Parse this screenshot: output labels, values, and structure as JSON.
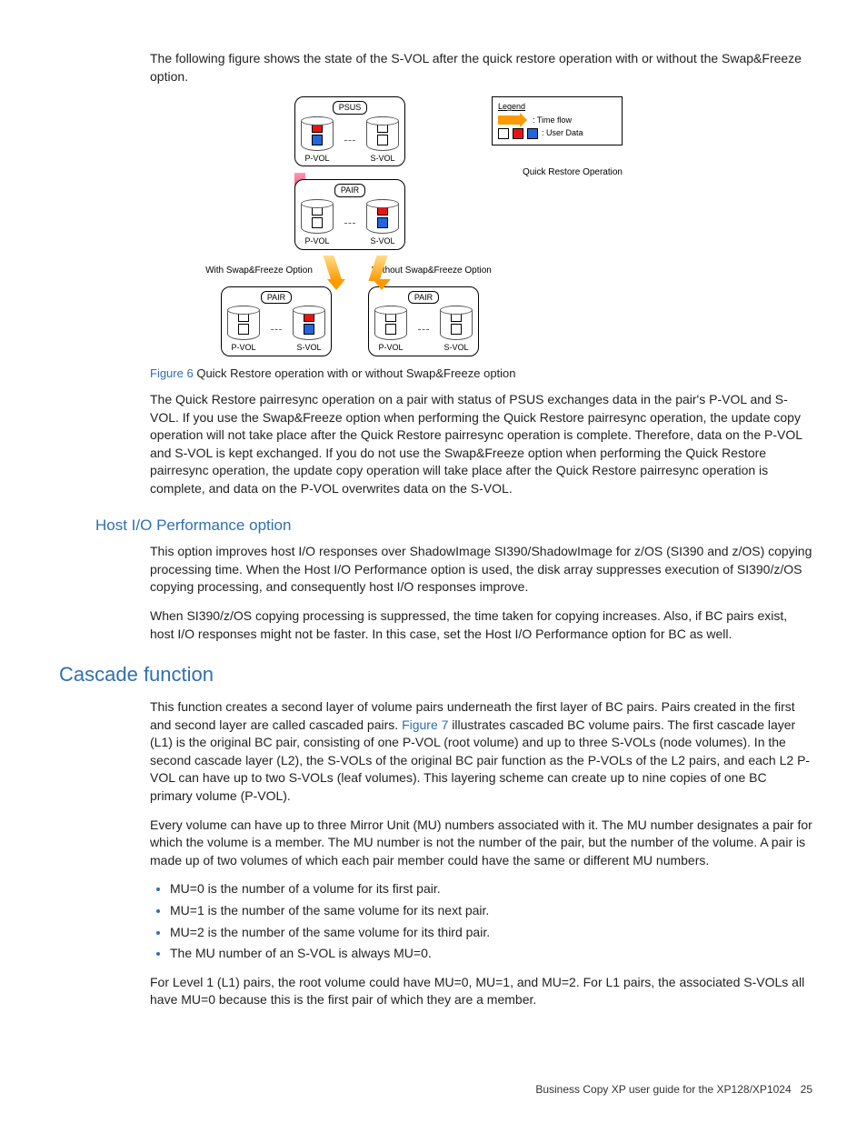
{
  "intro": "The following figure shows the state of the S-VOL after the quick restore operation with or without the Swap&Freeze option.",
  "diagram": {
    "status_psus": "PSUS",
    "status_pair": "PAIR",
    "pvol": "P-VOL",
    "svol": "S-VOL",
    "legend_title": "Legend",
    "legend_timeflow": ": Time flow",
    "legend_userdata": ": User Data",
    "quick_restore": "Quick Restore Operation",
    "with_opt": "With Swap&Freeze Option",
    "without_opt": "Without Swap&Freeze Option"
  },
  "figure_caption_label": "Figure 6",
  "figure_caption_text": "Quick Restore operation with or without Swap&Freeze option",
  "para_after_figure": "The Quick Restore pairresync operation on a pair with status of PSUS exchanges data in the pair's P-VOL and S-VOL. If you use the Swap&Freeze option when performing the Quick Restore pairresync operation, the update copy operation will not take place after the Quick Restore pairresync operation is complete. Therefore, data on the P-VOL and S-VOL is kept exchanged. If you do not use the Swap&Freeze option when performing the Quick Restore pairresync operation, the update copy operation will take place after the Quick Restore pairresync operation is complete, and data on the P-VOL overwrites data on the S-VOL.",
  "h3_hostio": "Host I/O Performance option",
  "hostio_p1": "This option improves host I/O responses over ShadowImage SI390/ShadowImage for z/OS (SI390 and z/OS) copying processing time. When the Host I/O Performance option is used, the disk array suppresses execution of SI390/z/OS copying processing, and consequently host I/O responses improve.",
  "hostio_p2": "When SI390/z/OS copying processing is suppressed, the time taken for copying increases. Also, if BC pairs exist, host I/O responses might not be faster. In this case, set the Host I/O Performance option for BC as well.",
  "h2_cascade": "Cascade function",
  "cascade_p1a": "This function creates a second layer of volume pairs underneath the first layer of BC pairs. Pairs created in the first and second layer are called cascaded pairs. ",
  "cascade_link": "Figure 7",
  "cascade_p1b": " illustrates cascaded BC volume pairs. The first cascade layer (L1) is the original BC pair, consisting of one P-VOL (root volume) and up to three S-VOLs (node volumes). In the second cascade layer (L2), the S-VOLs of the original BC pair function as the P-VOLs of the L2 pairs, and each L2 P-VOL can have up to two S-VOLs (leaf volumes). This layering scheme can create up to nine copies of one BC primary volume (P-VOL).",
  "cascade_p2": "Every volume can have up to three Mirror Unit (MU) numbers associated with it. The MU number designates a pair for which the volume is a member. The MU number is not the number of the pair, but the number of the volume. A pair is made up of two volumes of which each pair member could have the same or different MU numbers.",
  "bullets": [
    "MU=0 is the number of a volume for its first pair.",
    "MU=1 is the number of the same volume for its next pair.",
    "MU=2 is the number of the same volume for its third pair.",
    "The MU number of an S-VOL is always MU=0."
  ],
  "cascade_p3": "For Level 1 (L1) pairs, the root volume could have MU=0, MU=1, and MU=2. For L1 pairs, the associated S-VOLs all have MU=0 because this is the first pair of which they are a member.",
  "footer_text": "Business Copy XP user guide for the XP128/XP1024",
  "footer_page": "25"
}
